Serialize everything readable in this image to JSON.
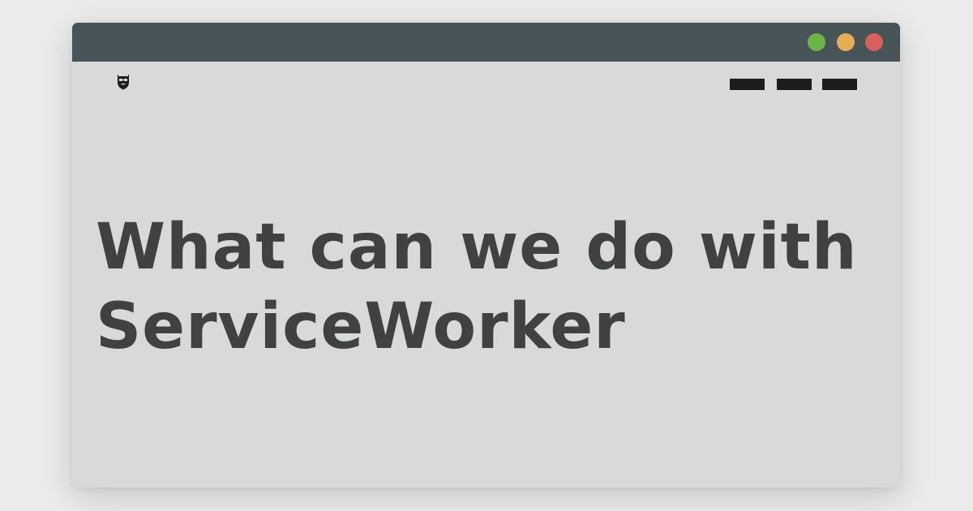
{
  "window": {
    "colors": {
      "titlebar": "#475458",
      "content": "#d8d9db",
      "traffic_green": "#6ab54a",
      "traffic_yellow": "#e5ae52",
      "traffic_red": "#d95f5a"
    }
  },
  "header": {
    "logo_icon": "masked-face-shield-icon",
    "nav_items": [
      "",
      "",
      ""
    ]
  },
  "main": {
    "headline_line_1": "What can we do with",
    "headline_line_2": "ServiceWorker"
  }
}
